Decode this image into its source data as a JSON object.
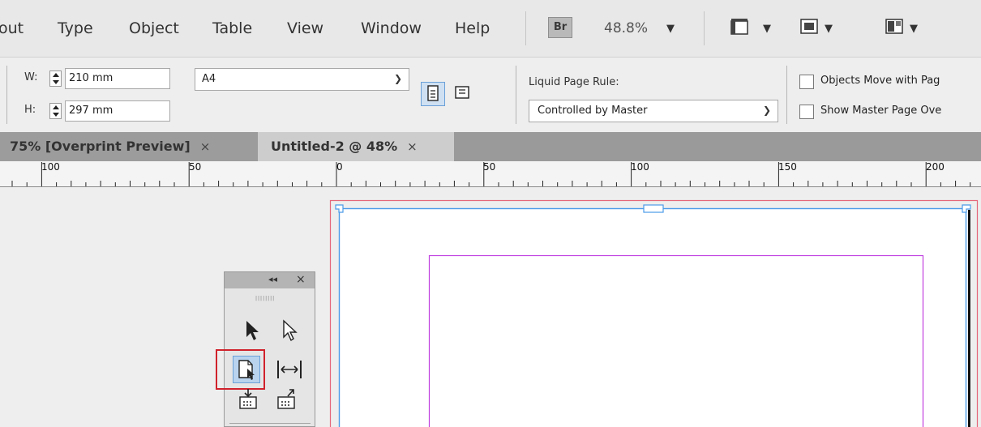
{
  "menu": {
    "items": [
      "out",
      "Type",
      "Object",
      "Table",
      "View",
      "Window",
      "Help"
    ],
    "bridge_label": "Br",
    "zoom": "48.8%",
    "screen_mode_icons": [
      "view-options-icon",
      "screen-mode-icon",
      "arrange-documents-icon"
    ]
  },
  "control_panel": {
    "width_label": "W:",
    "width_value": "210 mm",
    "height_label": "H:",
    "height_value": "297 mm",
    "page_size": "A4",
    "liquid_rule_label": "Liquid Page Rule:",
    "liquid_rule_value": "Controlled by Master",
    "checkbox_objects_move": "Objects Move with Pag",
    "checkbox_show_master": "Show Master Page Ove"
  },
  "tabs": [
    {
      "label": "75% [Overprint Preview]",
      "close": "×",
      "active": false
    },
    {
      "label": "Untitled-2 @ 48%",
      "close": "×",
      "active": true
    }
  ],
  "ruler": {
    "labels": [
      "100",
      "50",
      "0",
      "50",
      "100",
      "150",
      "200"
    ]
  },
  "tools_panel": {
    "collapse": "◂◂",
    "close": "×",
    "grip": "||||||||"
  },
  "colors": {
    "bleed": "#e5667a",
    "frame": "#4b9be8",
    "margin": "#c040e0",
    "highlight": "#d0212b",
    "selected_tool_bg": "#b9d3ee"
  }
}
